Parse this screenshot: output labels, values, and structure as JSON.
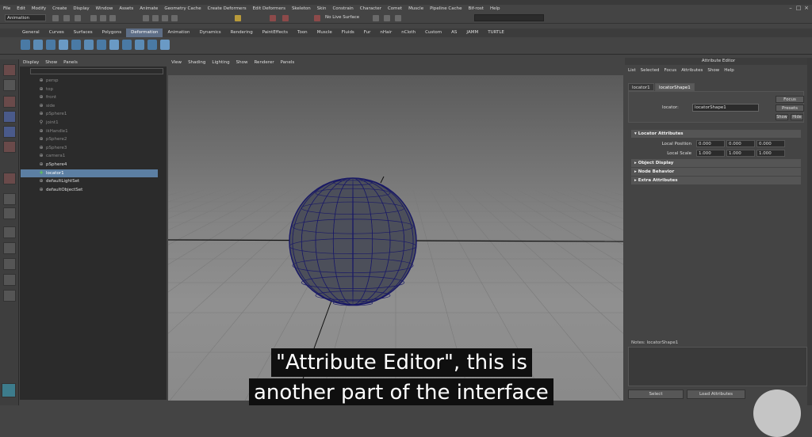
{
  "menubar": {
    "items": [
      "File",
      "Edit",
      "Modify",
      "Create",
      "Display",
      "Window",
      "Assets",
      "Animate",
      "Geometry Cache",
      "Create Deformers",
      "Edit Deformers",
      "Skeleton",
      "Skin",
      "Constrain",
      "Character",
      "Comet",
      "Muscle",
      "Pipeline Cache",
      "Bif-rost",
      "Help"
    ]
  },
  "statusline": {
    "mode": "Animation",
    "live_surface": "No Live Surface"
  },
  "shelf": {
    "tabs": [
      "General",
      "Curves",
      "Surfaces",
      "Polygons",
      "Deformation",
      "Animation",
      "Dynamics",
      "Rendering",
      "PaintEffects",
      "Toon",
      "Muscle",
      "Fluids",
      "Fur",
      "nHair",
      "nCloth",
      "Custom",
      "AS",
      "JAMM",
      "TURTLE"
    ],
    "active_tab": "Deformation"
  },
  "outliner": {
    "menu": [
      "Display",
      "Show",
      "Panels"
    ],
    "items": [
      {
        "label": "persp",
        "icon": "camera-icon",
        "dim": true,
        "selected": false
      },
      {
        "label": "top",
        "icon": "camera-icon",
        "dim": true,
        "selected": false
      },
      {
        "label": "front",
        "icon": "camera-icon",
        "dim": true,
        "selected": false
      },
      {
        "label": "side",
        "icon": "camera-icon",
        "dim": true,
        "selected": false
      },
      {
        "label": "pSphere1",
        "icon": "mesh-icon",
        "dim": true,
        "selected": false
      },
      {
        "label": "joint1",
        "icon": "joint-icon",
        "dim": true,
        "selected": false
      },
      {
        "label": "ikHandle1",
        "icon": "ik-icon",
        "dim": true,
        "selected": false
      },
      {
        "label": "pSphere2",
        "icon": "mesh-icon",
        "dim": true,
        "selected": false
      },
      {
        "label": "pSphere3",
        "icon": "mesh-icon",
        "dim": true,
        "selected": false
      },
      {
        "label": "camera1",
        "icon": "camera-icon",
        "dim": true,
        "selected": false
      },
      {
        "label": "pSphere4",
        "icon": "mesh-icon",
        "dim": false,
        "selected": false
      },
      {
        "label": "locator1",
        "icon": "locator-icon",
        "dim": false,
        "selected": true
      },
      {
        "label": "defaultLightSet",
        "icon": "set-icon",
        "dim": false,
        "selected": false
      },
      {
        "label": "defaultObjectSet",
        "icon": "set-icon",
        "dim": false,
        "selected": false
      }
    ]
  },
  "viewport": {
    "menu": [
      "View",
      "Shading",
      "Lighting",
      "Show",
      "Renderer",
      "Panels"
    ]
  },
  "attribute_editor": {
    "title": "Attribute Editor",
    "menu": [
      "List",
      "Selected",
      "Focus",
      "Attributes",
      "Show",
      "Help"
    ],
    "tabs": [
      "locator1",
      "locatorShape1"
    ],
    "active_tab": "locatorShape1",
    "node_label": "locator:",
    "node_value": "locatorShape1",
    "buttons": {
      "focus": "Focus",
      "presets": "Presets",
      "show": "Show",
      "hide": "Hide"
    },
    "sections": {
      "locator_attributes": "Locator Attributes",
      "object_display": "Object Display",
      "node_behavior": "Node Behavior",
      "extra_attributes": "Extra Attributes"
    },
    "local_position": {
      "label": "Local Position",
      "values": [
        "0.000",
        "0.000",
        "0.000"
      ]
    },
    "local_scale": {
      "label": "Local Scale",
      "values": [
        "1.000",
        "1.000",
        "1.000"
      ]
    },
    "notes_label": "Notes: locatorShape1",
    "bottom_buttons": {
      "select": "Select",
      "load_attributes": "Load Attributes"
    }
  },
  "captions": {
    "line1": "\"Attribute Editor\", this is",
    "line2": "another part of the interface"
  },
  "colors": {
    "selection": "#5c7fa3",
    "active_tab": "#5e6e86",
    "sphere": "#4a4e5c",
    "wire": "#1a1a66"
  }
}
